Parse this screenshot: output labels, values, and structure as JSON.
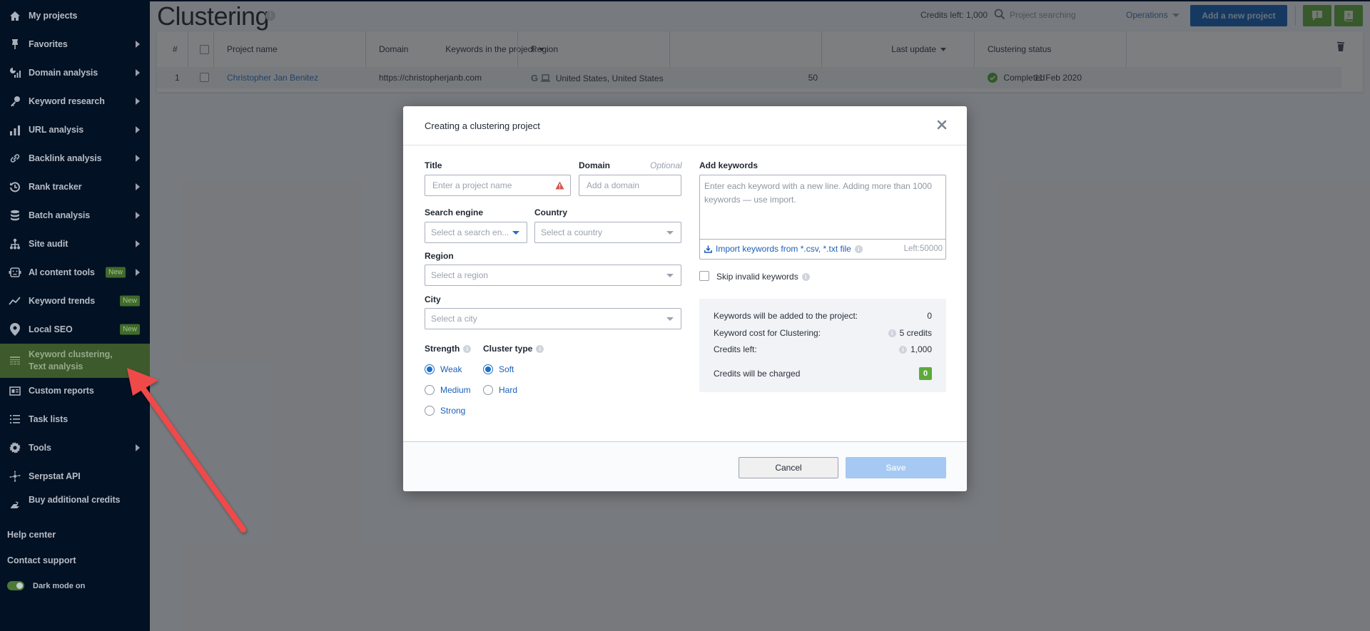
{
  "sidebar": {
    "items": [
      {
        "label": "My projects",
        "icon": "home-icon",
        "has_arrow": false
      },
      {
        "label": "Favorites",
        "icon": "pin-icon",
        "has_arrow": true
      },
      {
        "label": "Domain analysis",
        "icon": "domain-analysis-icon",
        "has_arrow": true
      },
      {
        "label": "Keyword research",
        "icon": "key-icon",
        "has_arrow": true
      },
      {
        "label": "URL analysis",
        "icon": "bar-chart-icon",
        "has_arrow": true
      },
      {
        "label": "Backlink analysis",
        "icon": "link-icon",
        "has_arrow": true
      },
      {
        "label": "Rank tracker",
        "icon": "history-icon",
        "has_arrow": true
      },
      {
        "label": "Batch analysis",
        "icon": "database-icon",
        "has_arrow": true
      },
      {
        "label": "Site audit",
        "icon": "sitemap-icon",
        "has_arrow": true
      },
      {
        "label": "AI content tools",
        "icon": "robot-icon",
        "has_arrow": true,
        "badge": "New"
      },
      {
        "label": "Keyword trends",
        "icon": "trend-icon",
        "has_arrow": false,
        "badge": "New"
      },
      {
        "label": "Local SEO",
        "icon": "map-pin-icon",
        "has_arrow": false,
        "badge": "New"
      },
      {
        "label": "Keyword clustering, Text analysis",
        "icon": "clustering-icon",
        "has_arrow": false,
        "active": true
      },
      {
        "label": "Custom reports",
        "icon": "report-card-icon",
        "has_arrow": false
      },
      {
        "label": "Task lists",
        "icon": "list-icon",
        "has_arrow": false
      },
      {
        "label": "Tools",
        "icon": "gear-icon",
        "has_arrow": true
      },
      {
        "label": "Serpstat API",
        "icon": "api-icon",
        "has_arrow": false
      },
      {
        "label": "Buy additional credits",
        "icon": "credits-icon",
        "has_arrow": false
      }
    ],
    "links": {
      "help": "Help center",
      "support": "Contact support"
    },
    "dark_mode_label": "Dark mode on",
    "dark_mode_on": true
  },
  "header": {
    "title": "Clustering",
    "credits_left": "Credits left: 1,000",
    "search_placeholder": "Project searching",
    "operations": "Operations",
    "add_project": "Add a new project"
  },
  "table": {
    "columns": [
      "#",
      "",
      "Project name",
      "Domain",
      "Region",
      "Keywords in the project",
      "Last update",
      "Clustering status"
    ],
    "rows": [
      {
        "num": "1",
        "name": "Christopher Jan Benitez",
        "domain": "https://christopherjanb.com",
        "region": "United States, United States",
        "keywords": "50",
        "last_update": "11 Feb 2020",
        "status": "Completed"
      }
    ]
  },
  "modal": {
    "title": "Creating a clustering project",
    "title_label": "Title",
    "title_placeholder": "Enter a project name",
    "domain_label": "Domain",
    "domain_optional": "Optional",
    "domain_placeholder": "Add a domain",
    "search_engine_label": "Search engine",
    "search_engine_placeholder": "Select a search en...",
    "country_label": "Country",
    "country_placeholder": "Select a country",
    "region_label": "Region",
    "region_placeholder": "Select a region",
    "city_label": "City",
    "city_placeholder": "Select a city",
    "strength_label": "Strength",
    "strength_options": [
      "Weak",
      "Medium",
      "Strong"
    ],
    "strength_selected": "Weak",
    "cluster_type_label": "Cluster type",
    "cluster_type_options": [
      "Soft",
      "Hard"
    ],
    "cluster_type_selected": "Soft",
    "keywords_label": "Add keywords",
    "keywords_placeholder": "Enter each keyword with a new line. Adding more than 1000 keywords — use import.",
    "import_link": "Import keywords from *.csv, *.txt file",
    "left_count": "Left:50000",
    "skip_invalid": "Skip invalid keywords",
    "summary": {
      "kw_added_label": "Keywords will be added to the project:",
      "kw_added_value": "0",
      "kw_cost_label": "Keyword cost for Clustering:",
      "kw_cost_value": "5 credits",
      "credits_left_label": "Credits left:",
      "credits_left_value": "1,000",
      "charged_label": "Credits will be charged",
      "charged_value": "0"
    },
    "cancel": "Cancel",
    "save": "Save"
  },
  "colors": {
    "sidebar_bg": "#021123",
    "active_item_bg": "#3c5a2b",
    "primary_blue": "#0d5cb6",
    "green": "#5daa3a",
    "annotation_arrow": "#f04848"
  }
}
